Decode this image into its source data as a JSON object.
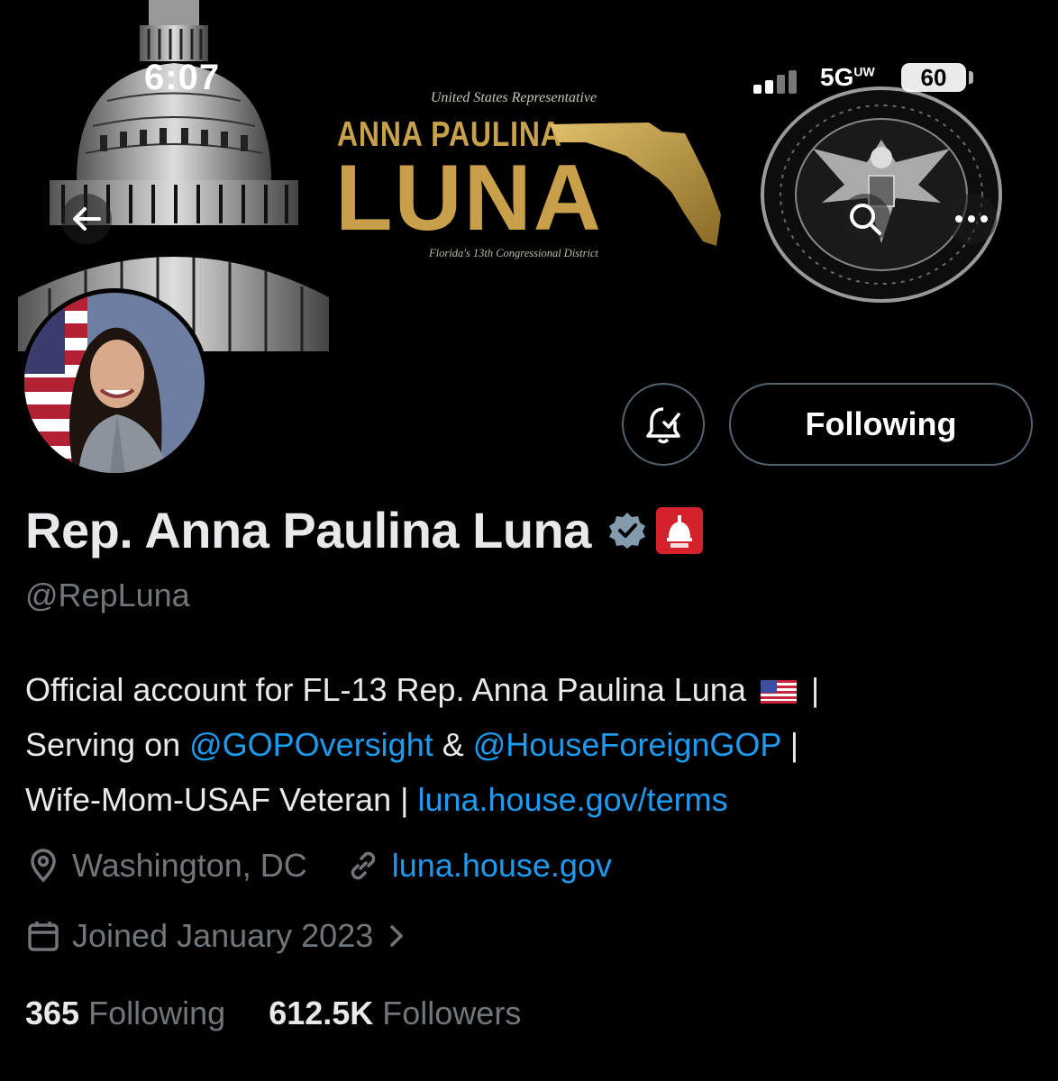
{
  "status_bar": {
    "time": "6:07",
    "network": "5G",
    "network_sup": "UW",
    "battery": "60"
  },
  "banner": {
    "title_top": "United States Representative",
    "name_line1": "ANNA PAULINA",
    "name_line2": "LUNA",
    "subtitle": "Florida's 13th Congressional District"
  },
  "header_icons": {
    "back": "back-arrow-icon",
    "search": "search-icon",
    "more": "more-icon"
  },
  "actions": {
    "notify": "notification-bell-icon",
    "follow_label": "Following"
  },
  "profile": {
    "name": "Rep. Anna Paulina Luna",
    "handle": "@RepLuna",
    "verified_color": "#829aab",
    "affiliate_color": "#d4212c"
  },
  "bio": {
    "part1": "Official account for FL-13 Rep. Anna Paulina Luna",
    "sep1": " |",
    "part2": "Serving on ",
    "mention1": "@GOPOversight",
    "and": " & ",
    "mention2": "@HouseForeignGOP",
    "sep2": " |",
    "part3": "Wife-Mom-USAF Veteran | ",
    "link": "luna.house.gov/terms"
  },
  "meta": {
    "location": "Washington, DC",
    "website": "luna.house.gov",
    "joined": "Joined January 2023"
  },
  "stats": {
    "following_count": "365",
    "following_label": " Following",
    "followers_count": "612.5K",
    "followers_label": " Followers"
  },
  "colors": {
    "link": "#1d9bf0",
    "muted": "#71767b",
    "text": "#e7e9ea",
    "gold": "#c7a049"
  }
}
